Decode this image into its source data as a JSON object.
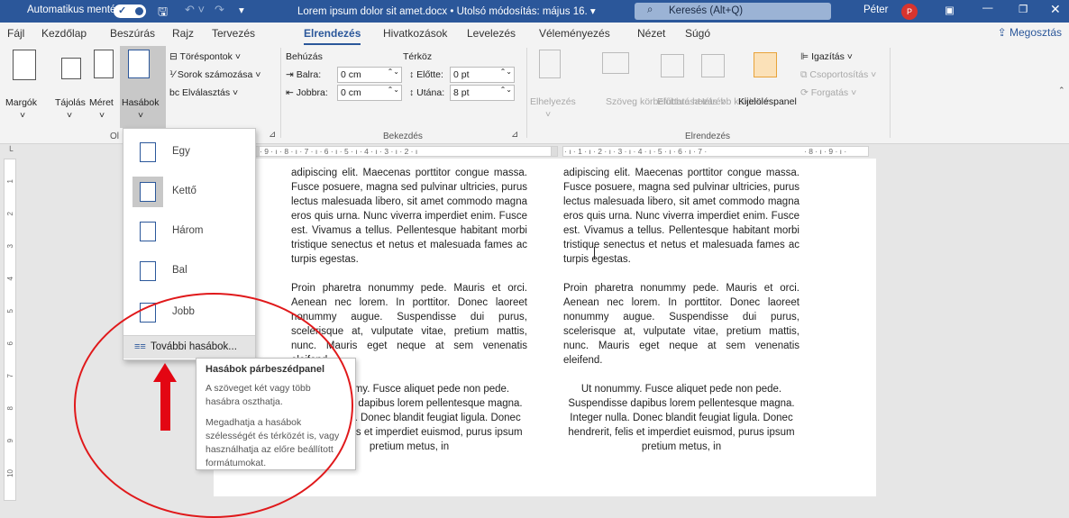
{
  "titlebar": {
    "autosave": "Automatikus mentés",
    "doc_title": "Lorem ipsum dolor sit amet.docx • Utolsó módosítás: május 16.",
    "search": "Keresés (Alt+Q)",
    "user": "Péter",
    "avatar_initial": "P",
    "color": "#2b579a"
  },
  "tabs": [
    "Fájl",
    "Kezdőlap",
    "Beszúrás",
    "Rajz",
    "Tervezés",
    "Elrendezés",
    "Hivatkozások",
    "Levelezés",
    "Véleményezés",
    "Nézet",
    "Súgó"
  ],
  "share": "Megosztás",
  "ribbon": {
    "margins": "Margók",
    "orientation": "Tájolás",
    "size": "Méret",
    "columns": "Hasábok",
    "breaks": "Töréspontok",
    "line_numbers": "Sorok számozása",
    "hyphenation": "Elválasztás",
    "group_page_setup": "Ol",
    "indent_title": "Behúzás",
    "spacing_title": "Térköz",
    "left": "Balra:",
    "left_val": "0 cm",
    "right": "Jobbra:",
    "right_val": "0 cm",
    "before": "Előtte:",
    "before_val": "0 pt",
    "after": "Utána:",
    "after_val": "8 pt",
    "group_paragraph": "Bekezdés",
    "position": "Elhelyezés",
    "wrap": "Szöveg körbefuttatása",
    "forward": "Előbbre hozás",
    "backward": "Hátrébb küldés",
    "selection_pane": "Kijelöléspanel",
    "align": "Igazítás",
    "group_objects": "Csoportosítás",
    "rotate": "Forgatás",
    "group_arrange": "Elrendezés"
  },
  "ruler": {
    "left_nums": "· 9 · ı · 8 · ı · 7 · ı · 6 · ı · 5 · ı · 4 · ı · 3 · ı · 2 · ı",
    "right_nums": "· ı · 1 · ı · 2 · ı · 3 · ı · 4 · ı · 5 · ı · 6 · ı · 7 ·",
    "right_tail": "· 8 · ı · 9 · ı ·",
    "vertical": [
      "1",
      "2",
      "3",
      "4",
      "5",
      "6",
      "7",
      "8",
      "9",
      "10"
    ]
  },
  "dropdown": {
    "items": [
      "Egy",
      "Kettő",
      "Három",
      "Bal",
      "Jobb"
    ],
    "selected": "Kettő",
    "more": "További hasábok..."
  },
  "tooltip": {
    "title": "Hasábok párbeszédpanel",
    "line1": "A szöveget két vagy több hasábra oszthatja.",
    "line2": "Megadhatja a hasábok szélességét és térközét is, vagy használhatja az előre beállított formátumokat."
  },
  "document": {
    "left": {
      "p1": "adipiscing elit. Maecenas porttitor congue massa. Fusce posuere, magna sed pulvinar ultricies, purus lectus malesuada libero, sit amet commodo magna eros quis urna. Nunc viverra imperdiet enim. Fusce est. Vivamus a tellus. Pellentesque habitant morbi tristique senectus et netus et malesuada fames ac turpis egestas.",
      "p2": "Proin pharetra nonummy pede. Mauris et orci. Aenean nec lorem. In porttitor. Donec laoreet nonummy augue. Suspendisse dui purus, scelerisque at, vulputate vitae, pretium mattis, nunc. Mauris eget neque at sem venenatis eleifend.",
      "p3": "Ut nonummy. Fusce aliquet pede non pede. Suspendisse dapibus lorem pellentesque magna. Integer nulla. Donec blandit feugiat ligula. Donec hendrerit, felis et imperdiet euismod, purus ipsum pretium metus, in"
    },
    "right": {
      "p1": "adipiscing elit. Maecenas porttitor congue massa. Fusce posuere, magna sed pulvinar ultricies, purus lectus malesuada libero, sit amet commodo magna eros quis urna. Nunc viverra imperdiet enim. Fusce est. Vivamus a tellus. Pellentesque habitant morbi tristique senectus et netus et malesuada fames ac turpis egestas.",
      "p2": "Proin pharetra nonummy pede. Mauris et orci. Aenean nec lorem. In porttitor. Donec laoreet nonummy augue. Suspendisse dui purus, scelerisque at, vulputate vitae, pretium mattis, nunc. Mauris eget neque at sem venenatis eleifend.",
      "p3": "Ut nonummy. Fusce aliquet pede non pede. Suspendisse dapibus lorem pellentesque magna. Integer nulla. Donec blandit feugiat ligula. Donec hendrerit, felis et imperdiet euismod, purus ipsum pretium metus, in"
    }
  },
  "annotation_color": "#e30613"
}
